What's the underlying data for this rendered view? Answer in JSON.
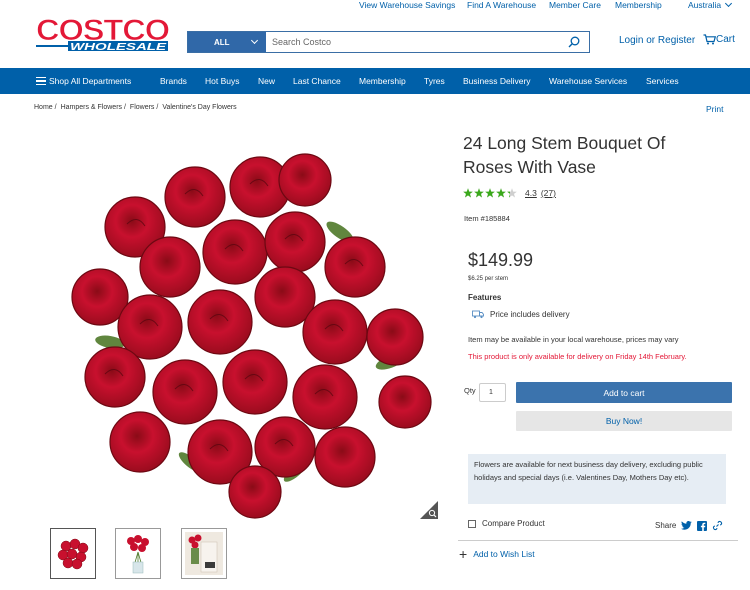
{
  "util_links": {
    "view_warehouse_savings": "View Warehouse Savings",
    "find_a_warehouse": "Find A Warehouse",
    "member_care": "Member Care",
    "membership": "Membership",
    "country": "Australia"
  },
  "logo": {
    "line1": "COSTCO",
    "line2": "WHOLESALE"
  },
  "search": {
    "category": "ALL",
    "placeholder": "Search Costco"
  },
  "header": {
    "login": "Login or Register",
    "cart": "Cart"
  },
  "nav": {
    "shop_all": "Shop All Departments",
    "brands": "Brands",
    "hot_buys": "Hot Buys",
    "new": "New",
    "last_chance": "Last Chance",
    "membership": "Membership",
    "tyres": "Tyres",
    "business_delivery": "Business Delivery",
    "warehouse_services": "Warehouse Services",
    "services": "Services"
  },
  "breadcrumb": {
    "home": "Home /",
    "hampers": "Hampers & Flowers /",
    "flowers": "Flowers /",
    "valentines": "Valentine's Day Flowers"
  },
  "print": "Print",
  "product": {
    "title": "24 Long Stem Bouquet Of Roses With Vase",
    "rating": 4.3,
    "rating_text": "4.3",
    "review_count": "(27)",
    "item_number": "Item #185884",
    "price": "$149.99",
    "per_stem": "$6.25 per stem",
    "features_heading": "Features",
    "feature_delivery": "Price includes delivery",
    "availability_note": "Item may be available in your local warehouse, prices may vary",
    "delivery_warning": "This product is only available for delivery on Friday 14th February.",
    "qty_label": "Qty",
    "qty_value": "1",
    "add_to_cart": "Add to cart",
    "buy_now": "Buy Now!",
    "info_box": "Flowers are available for next business day delivery, excluding public holidays and special days (i.e. Valentines Day, Mothers Day etc).",
    "compare": "Compare Product",
    "share": "Share",
    "wishlist": "Add to Wish List"
  },
  "colors": {
    "brand_blue": "#0060a9",
    "logo_red": "#e31837",
    "star_green": "#3aa91b",
    "rose_red": "#c8102e"
  }
}
